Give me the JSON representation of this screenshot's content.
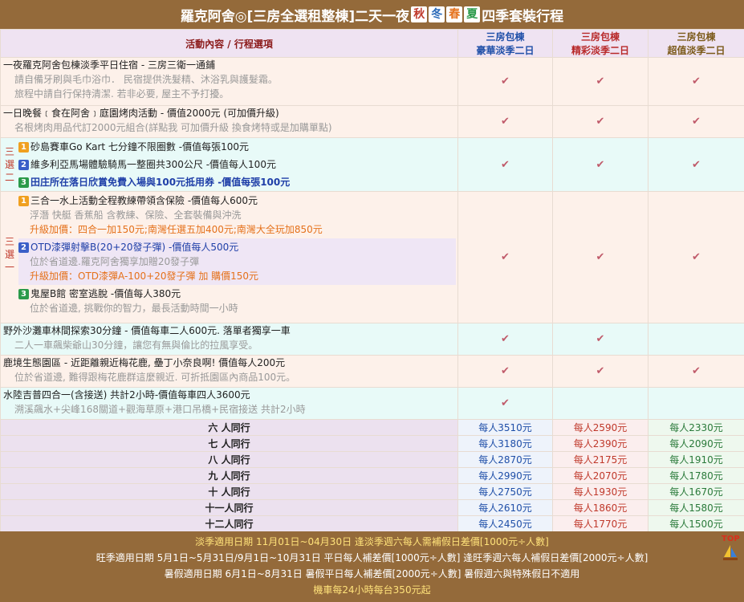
{
  "title": {
    "pre": "羅克阿舍◎[三房全選租整棟]二天一夜",
    "seasons": [
      "秋",
      "冬",
      "春",
      "夏"
    ],
    "post": "四季套裝行程"
  },
  "header": {
    "activity": "活動內容 / 行程選項",
    "col1": [
      "三房包棟",
      "豪華淡季二日"
    ],
    "col2": [
      "三房包棟",
      "精彩淡季二日"
    ],
    "col3": [
      "三房包棟",
      "超值淡季二日"
    ]
  },
  "check": "✔",
  "rows": {
    "r1": {
      "main": "一夜羅克阿舍包棟淡季平日住宿 - 三房三衛一通鋪",
      "sub1": "請自備牙刷與毛巾浴巾． 民宿提供洗髮精、沐浴乳與護髮霜。",
      "sub2": "旅程中請自行保持清潔. 若非必要, 屋主不予打擾。"
    },
    "r2": {
      "main": "一日晚餐﹝食在阿舍﹞庭園烤肉活動 - 價值2000元 (可加價升級)",
      "sub": "名根烤肉用品代訂2000元組合(詳點我 可加價升級 換食烤特或是加購單點)"
    },
    "g1": {
      "side": [
        "三",
        "選",
        "二"
      ],
      "o1": "砂島賽車Go Kart 七分鐘不限圈數 -價值每張100元",
      "o2": "維多利亞馬場體驗騎馬一整圈共300公尺 -價值每人100元",
      "o3": "田庄所在落日欣賞免費入場與100元抵用券 -價值每張100元"
    },
    "g2": {
      "side": [
        "三",
        "選",
        "一"
      ],
      "o1": "三合一水上活動全程教練帶領含保險 -價值每人600元",
      "o1s": "浮潛 快艇 香蕉船 含教練、保險、全套裝備與沖洗",
      "o1u": "升級加價：四合一加150元;南灣任選五加400元;南灣大全玩加850元",
      "o2": "OTD漆彈射擊B(20+20發子彈) -價值每人500元",
      "o2s": "位於省道邊.羅克阿舍獨享加贈20發子彈",
      "o2u": "升級加價：OTD漆彈A-100+20發子彈 加 購價150元",
      "o3": "鬼屋B館 密室逃脫 -價值每人380元",
      "o3s": "位於省道邊, 挑戰你的智力，最長活動時間一小時"
    },
    "r3": {
      "main": "野外沙灘車林間探索30分鐘 - 價值每車二人600元. 落單者獨享一車",
      "sub": "二人一車飆柴爺山30分鐘，讓您有無與倫比的拉風享受。"
    },
    "r4": {
      "main": "鹿境生態園區 - 近距離親近梅花鹿, 壘丁小奈良啊! 價值每人200元",
      "sub": "位於省道邊, 難得跟梅花鹿群這麼親近. 可折抵園區內商品100元。"
    },
    "r5": {
      "main": "水陸吉普四合一(含接送) 共計2小時-價值每車四人3600元",
      "sub": "溯溪飆水+尖峰168關道+觀海草原+港口吊橋+民宿接送 共計2小時"
    }
  },
  "prices": [
    {
      "label": "六  人同行",
      "p1": "每人3510元",
      "p2": "每人2590元",
      "p3": "每人2330元"
    },
    {
      "label": "七  人同行",
      "p1": "每人3180元",
      "p2": "每人2390元",
      "p3": "每人2090元"
    },
    {
      "label": "八  人同行",
      "p1": "每人2870元",
      "p2": "每人2175元",
      "p3": "每人1910元"
    },
    {
      "label": "九  人同行",
      "p1": "每人2990元",
      "p2": "每人2070元",
      "p3": "每人1780元"
    },
    {
      "label": "十  人同行",
      "p1": "每人2750元",
      "p2": "每人1930元",
      "p3": "每人1670元"
    },
    {
      "label": "十一人同行",
      "p1": "每人2610元",
      "p2": "每人1860元",
      "p3": "每人1580元"
    },
    {
      "label": "十二人同行",
      "p1": "每人2450元",
      "p2": "每人1770元",
      "p3": "每人1500元"
    }
  ],
  "footer": {
    "line1": "淡季適用日期 11月01日~04月30日 逢淡季週六每人需補假日差價[1000元÷人數]",
    "line2": "旺季適用日期 5月1日~5月31日/9月1日~10月31日 平日每人補差價[1000元÷人數] 逢旺季週六每人補假日差價[2000元÷人數]",
    "line3": "暑假適用日期 6月1日~8月31日 暑假平日每人補差價[2000元÷人數] 暑假週六與特殊假日不適用",
    "line4": "機車每24小時每台350元起",
    "top_label": "TOP"
  },
  "colors": {
    "header_bg": "#946a3a",
    "accent": "#ffe27a",
    "check": "#c05a6a"
  }
}
